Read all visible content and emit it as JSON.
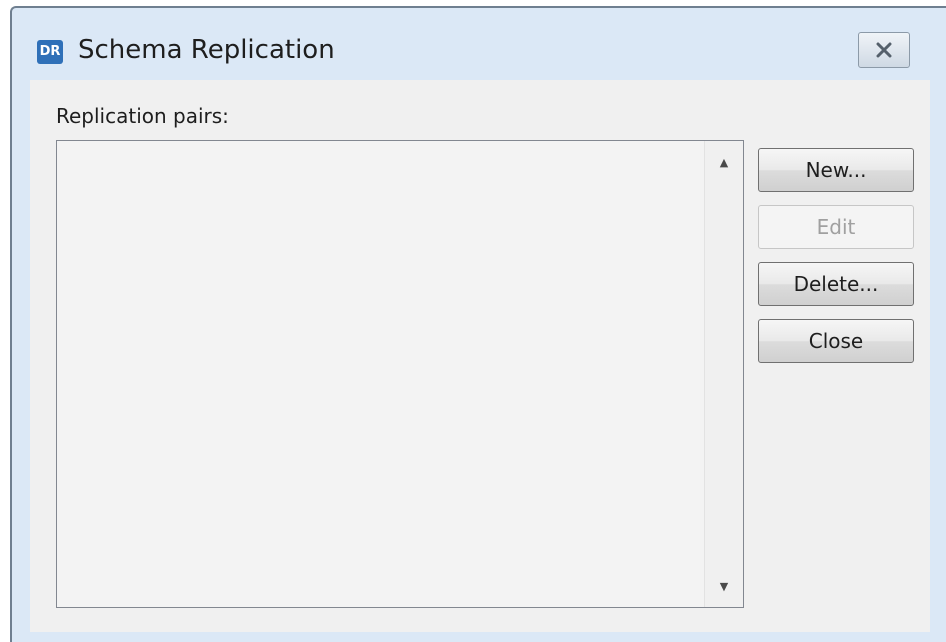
{
  "window": {
    "title": "Schema Replication",
    "app_icon": "DR",
    "close_icon": "close-icon"
  },
  "replication_pairs": {
    "label": "Replication pairs:",
    "items": []
  },
  "buttons": {
    "new": "New...",
    "edit": "Edit",
    "delete": "Delete...",
    "close": "Close"
  },
  "colors": {
    "title_bar": "#dbe8f6",
    "client_area": "#f0f0f0",
    "app_icon": "#2f70b8",
    "disabled_text": "#a0a0a0"
  }
}
